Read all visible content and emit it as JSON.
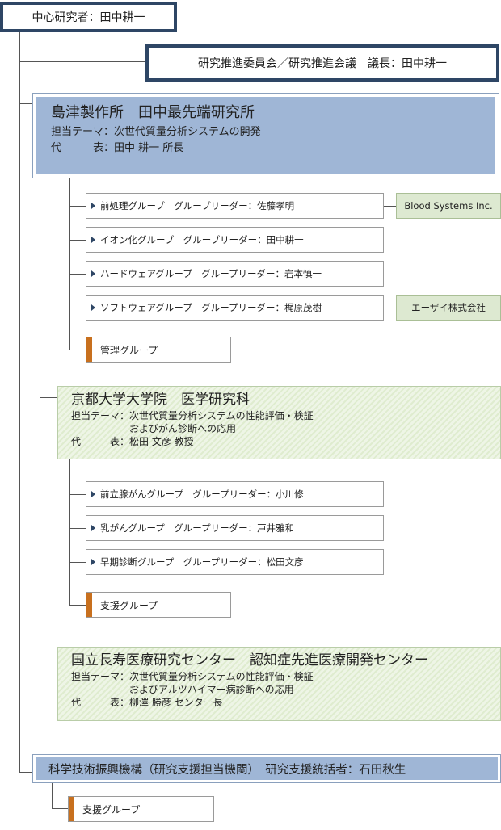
{
  "center_researcher": "中心研究者：田中耕一",
  "committee": "研究推進委員会／研究推進会議　議長：田中耕一",
  "shimadzu": {
    "title": "島津製作所　田中最先端研究所",
    "theme_key": "担当テーマ：",
    "theme": "次世代質量分析システムの開発",
    "rep_key": "代　　　表：",
    "rep": "田中 耕一 所長",
    "groups": [
      {
        "label": "前処理グループ　グループリーダー：佐藤孝明",
        "partner": "Blood Systems Inc."
      },
      {
        "label": "イオン化グループ　グループリーダー：田中耕一",
        "partner": ""
      },
      {
        "label": "ハードウェアグループ　グループリーダー：岩本慎一",
        "partner": ""
      },
      {
        "label": "ソフトウェアグループ　グループリーダー：梶原茂樹",
        "partner": "エーザイ株式会社"
      }
    ],
    "support_group": "管理グループ"
  },
  "kyoto": {
    "title": "京都大学大学院　医学研究科",
    "theme_key": "担当テーマ：",
    "theme": "次世代質量分析システムの性能評価・検証",
    "theme_line2": "およびがん診断への応用",
    "rep_key": "代　　　表：",
    "rep": "松田 文彦 教授",
    "groups": [
      {
        "label": "前立腺がんグループ　グループリーダー：小川修"
      },
      {
        "label": "乳がんグループ　グループリーダー：戸井雅和"
      },
      {
        "label": "早期診断グループ　グループリーダー：松田文彦"
      }
    ],
    "support_group": "支援グループ"
  },
  "ncgg": {
    "title": "国立長寿医療研究センター　認知症先進医療開発センター",
    "theme_key": "担当テーマ：",
    "theme": "次世代質量分析システムの性能評価・検証",
    "theme_line2": "およびアルツハイマー病診断への応用",
    "rep_key": "代　　　表：",
    "rep": "柳澤 勝彦 センター長"
  },
  "jst": {
    "title": "科学技術振興機構（研究支援担当機関）　研究支援統括者：石田秋生",
    "support_group": "支援グループ"
  },
  "colors": {
    "navy": "#2e4665",
    "blue_fill": "#9fb6d6",
    "green_fill": "#dfeccf",
    "orange_bar": "#c8701e"
  }
}
